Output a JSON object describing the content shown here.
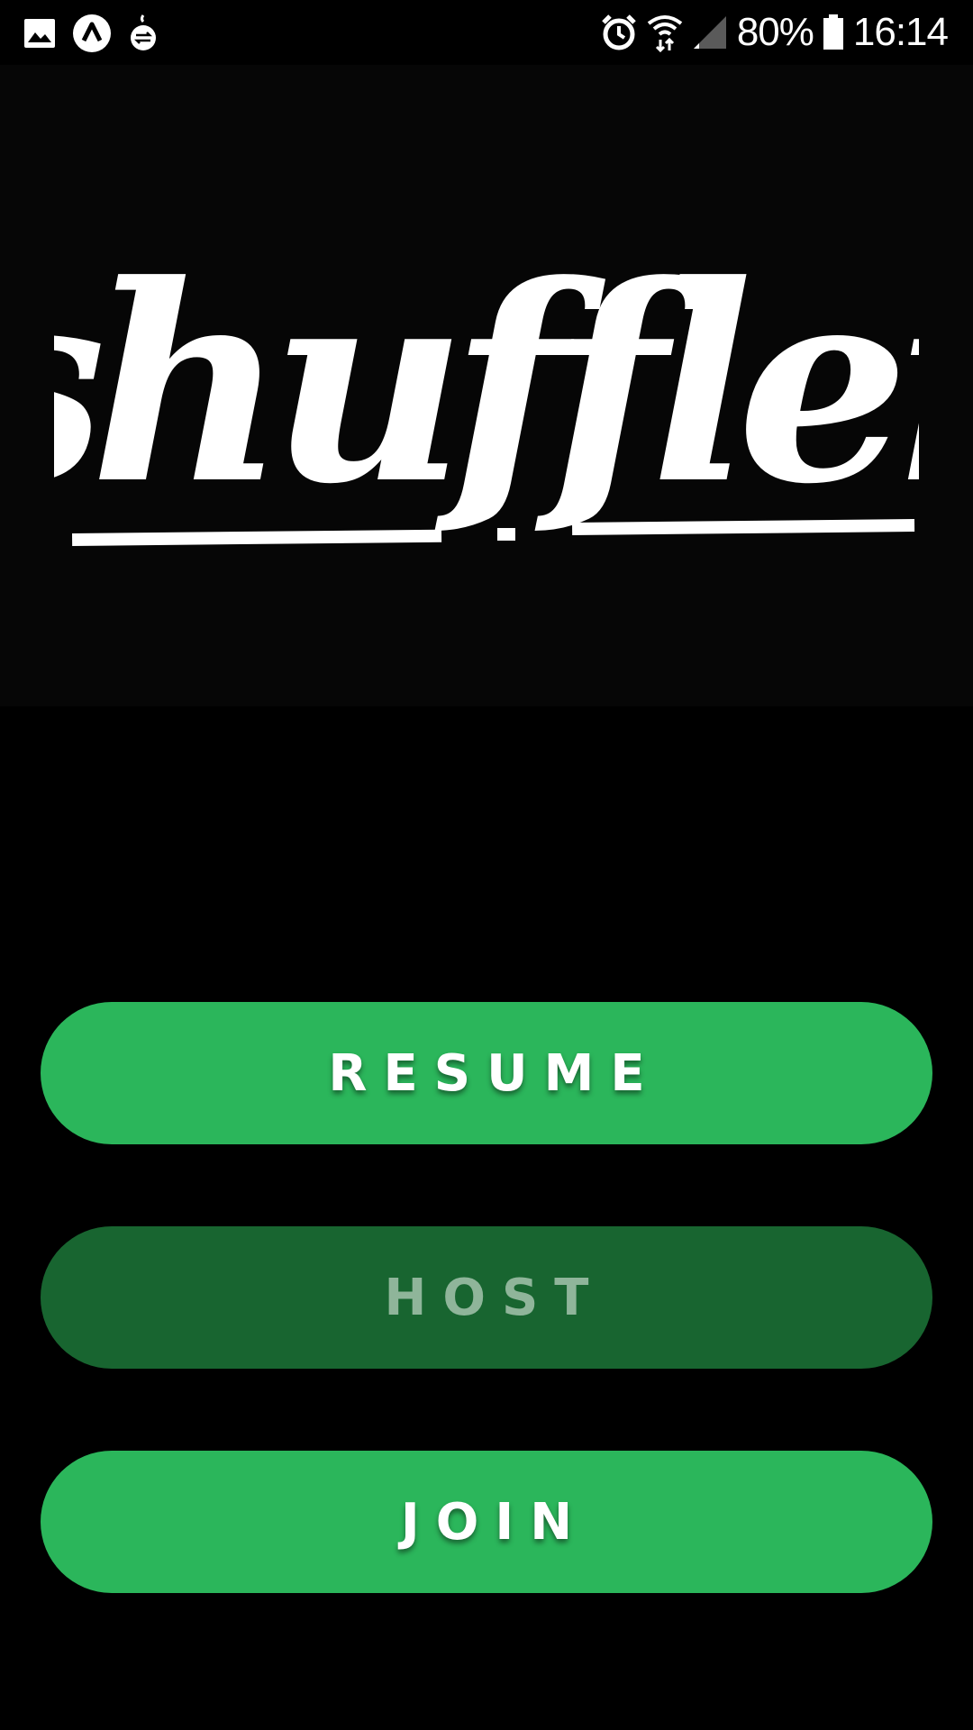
{
  "status_bar": {
    "left_icons": [
      "image-icon",
      "app-logo-icon",
      "bomb-sync-icon"
    ],
    "right_icons": [
      "alarm-icon",
      "wifi-icon",
      "signal-icon",
      "battery-icon"
    ],
    "battery_percent": "80%",
    "time": "16:14"
  },
  "logo": {
    "text": "shuffler"
  },
  "buttons": {
    "resume_label": "RESUME",
    "host_label": "HOST",
    "join_label": "JOIN"
  },
  "colors": {
    "background": "#000000",
    "button_active": "#2bb65b",
    "button_disabled": "#186530",
    "button_disabled_text": "#8fb59a"
  }
}
